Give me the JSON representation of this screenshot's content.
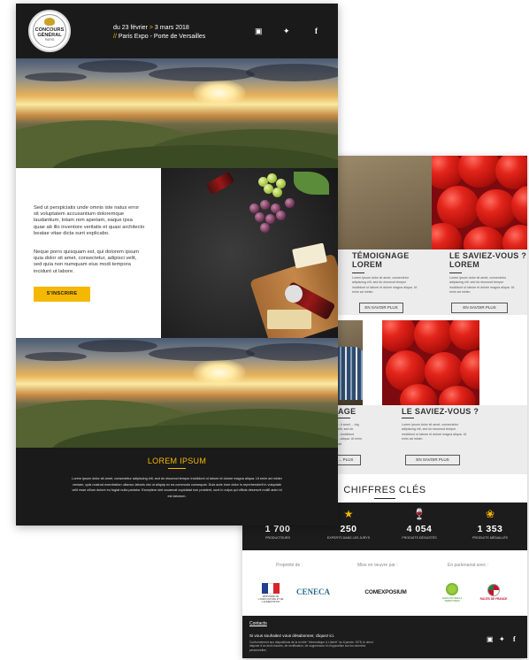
{
  "front_email": {
    "header": {
      "logo_line1": "CONCOURS",
      "logo_line2": "GÉNÉRAL",
      "logo_line3": "PARIS",
      "date_prefix": "du 23 février ",
      "date_sep": ">",
      "date_end": " 3 mars 2018",
      "place_sep": "//",
      "place": " Paris Expo - Porte de Versailles",
      "social": [
        "instagram-icon",
        "twitter-icon",
        "facebook-icon"
      ]
    },
    "intro": {
      "paragraph1": "Sed ut perspiciatis unde omnis iste natus error sit voluptatem accusantium doloremque laudantium, totam rem aperiam, eaque ipsa quae ab illo inventore veritatis et quasi architecto beatae vitae dicta sunt explicabo.",
      "paragraph2": "Neque porro quisquam est, qui dolorem ipsum quia dolor sit amet, consectetur, adipisci velit, sed quia non numquam eius modi tempora incidunt ut labore.",
      "cta_label": "S'INSCRIRE"
    },
    "footer": {
      "title": "LOREM IPSUM",
      "text": "Lorem ipsum dolor sit amet, consectetur adipiscing elit, sed do eiusmod tempor incididunt ut labore et dolore magna aliqua. Ut enim ad minim veniam, quis nostrud exercitation ullamco laboris nisi ut aliquip ex ea commodo consequat. Duis aute irure dolor in reprehenderit in voluptate velit esse cillum dolore eu fugiat nulla pariatur. Excepteur sint occaecat cupidatat non proident, sunt in culpa qui officia deserunt mollit anim id est laborum."
    },
    "colors": {
      "accent": "#f5b800",
      "dark": "#1a1a1a"
    }
  },
  "back_email": {
    "blocks": [
      {
        "title_l1": "TÉMOIGNAGE",
        "title_l2": "LOREM",
        "text": "Lorem ipsum dolor sit amet, consectetur adipiscing elit, sed do eiusmod tempor incididunt ut labore et dolore magna aliqua. Ut enim ad minim.",
        "button": "EN SAVOIR PLUS"
      },
      {
        "title_l1": "LE SAVIEZ-VOUS ?",
        "title_l2": "LOREM",
        "text": "Lorem ipsum dolor sit amet, consectetur adipiscing elit, sed do eiusmod tempor incididunt ut labore et dolore magna aliqua. Ut enim ad minim.",
        "button": "EN SAVOIR PLUS"
      },
      {
        "title_l1": "AGE",
        "title_l2": "",
        "text": "...it amet, ...ing elit, sed do ...incididunt ...aliqua. Ut enim ad",
        "button": "... PLUS"
      },
      {
        "title_l1": "LE SAVIEZ-VOUS ?",
        "title_l2": "",
        "text": "Lorem ipsum dolor sit amet, consectetur adipiscing elit, sed do eiusmod tempor incididunt ut labore et dolore magna aliqua. Ut enim ad minim.",
        "button": "EN SAVOIR PLUS"
      }
    ],
    "chiffres_title": "CHIFFRES CLÉS",
    "stats": [
      {
        "icon": "gavel-icon",
        "number": "1 700",
        "label": "PRODUCTEURS"
      },
      {
        "icon": "jury-icon",
        "number": "250",
        "label": "EXPERTS DANS LES JURYS"
      },
      {
        "icon": "wine-icon",
        "number": "4 054",
        "label": "PRODUITS DÉGUSTÉS"
      },
      {
        "icon": "wheat-icon",
        "number": "1 353",
        "label": "PRODUITS MÉDAILLÉS"
      }
    ],
    "partners": {
      "cap1": "Propriété de :",
      "cap2": "Mise en oeuvre par :",
      "cap3": "En partenariat avec :",
      "logo_ministere": "MINISTÈRE DE L'AGRICULTURE ET DE L'ALIMENTATION",
      "logo_ceneca": "CENECA",
      "logo_comexposium": "COMEXPOSIUM",
      "logo_agriculteurs": "AGRICULTURES & TERRITOIRES",
      "logo_races": "RACES DE FRANCE"
    },
    "footer": {
      "contact": "Contacts",
      "unsubscribe": "Si vous souhaitez vous désabonner, cliquez ici.",
      "legal": "Conformément aux dispositions de la loi dite \"Informatique & Liberté\" du 6 janvier 1978, le client dispose d'un droit d'accès, de rectification, de suppression et d'opposition sur les données personnelles.",
      "social": [
        "instagram-icon",
        "twitter-icon",
        "facebook-icon"
      ]
    }
  }
}
